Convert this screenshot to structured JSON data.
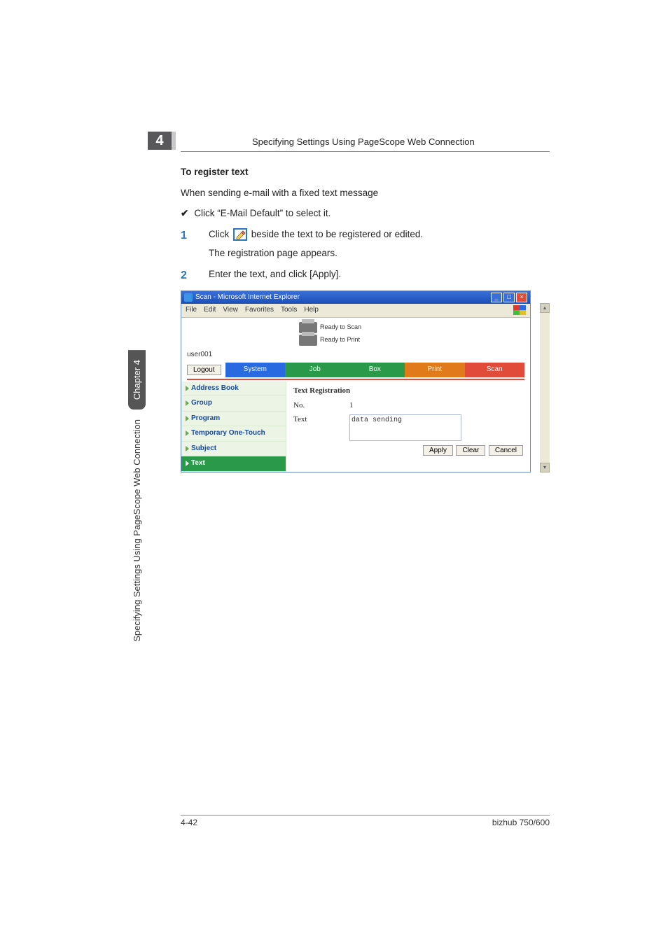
{
  "chapter_number": "4",
  "header_title": "Specifying Settings Using PageScope Web Connection",
  "side": {
    "chapter": "Chapter 4",
    "long": "Specifying Settings Using PageScope Web Connection"
  },
  "sub_heading": "To register text",
  "intro": "When sending e-mail with a fixed text message",
  "check_item": "Click “E-Mail Default” to select it.",
  "steps": [
    {
      "num": "1",
      "pre": "Click ",
      "post": " beside the text to be registered or edited.",
      "sub": "The registration page appears."
    },
    {
      "num": "2",
      "text": "Enter the text, and click [Apply]."
    }
  ],
  "screenshot": {
    "window_title": "Scan - Microsoft Internet Explorer",
    "menubar": [
      "File",
      "Edit",
      "View",
      "Favorites",
      "Tools",
      "Help"
    ],
    "status": {
      "scan": "Ready to Scan",
      "print": "Ready to Print"
    },
    "user": "user001",
    "logout": "Logout",
    "tabs": {
      "system": "System",
      "job": "Job",
      "box": "Box",
      "print": "Print",
      "scan": "Scan"
    },
    "nav": [
      "Address Book",
      "Group",
      "Program",
      "Temporary One-Touch",
      "Subject",
      "Text"
    ],
    "panel": {
      "title": "Text Registration",
      "no_label": "No.",
      "no_value": "1",
      "text_label": "Text",
      "text_value": "data sending",
      "buttons": {
        "apply": "Apply",
        "clear": "Clear",
        "cancel": "Cancel"
      }
    }
  },
  "footer": {
    "left": "4-42",
    "right": "bizhub 750/600"
  }
}
